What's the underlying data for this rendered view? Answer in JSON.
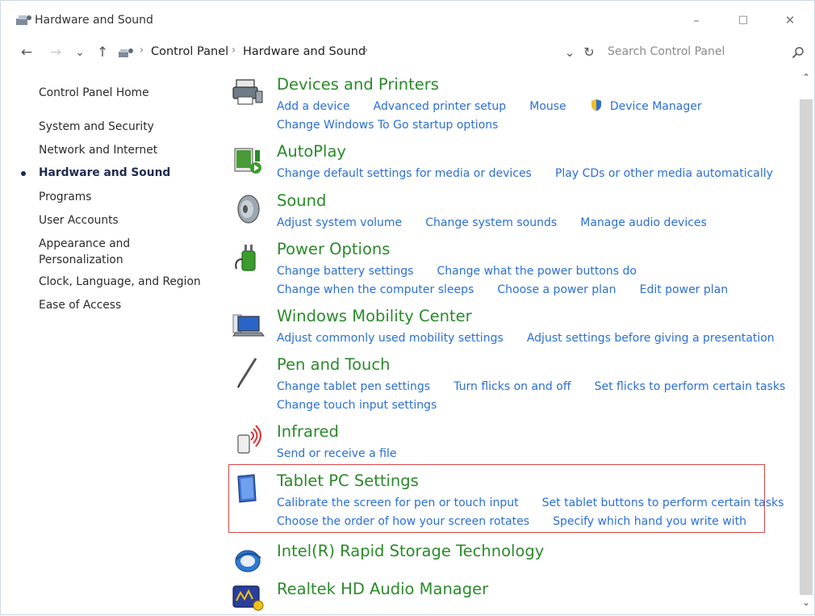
{
  "window": {
    "title": "Hardware and Sound",
    "minimize": "–",
    "maximize": "□",
    "close": "✕"
  },
  "address": {
    "back": "←",
    "forward": "→",
    "recent": "⌄",
    "up": "↑",
    "crumbs": [
      "Control Panel",
      "Hardware and Sound"
    ],
    "sep": "›",
    "dropdown": "⌄",
    "refresh": "↻",
    "search_placeholder": "Search Control Panel"
  },
  "sidebar": {
    "items": [
      {
        "label": "Control Panel Home"
      },
      {
        "label": "System and Security"
      },
      {
        "label": "Network and Internet"
      },
      {
        "label": "Hardware and Sound",
        "active": true
      },
      {
        "label": "Programs"
      },
      {
        "label": "User Accounts"
      },
      {
        "label": "Appearance and Personalization"
      },
      {
        "label": "Clock, Language, and Region"
      },
      {
        "label": "Ease of Access"
      }
    ]
  },
  "categories": [
    {
      "title": "Devices and Printers",
      "icon": "printer-icon",
      "lines": [
        [
          "Add a device",
          "Advanced printer setup",
          "Mouse",
          "Device Manager"
        ],
        [
          "Change Windows To Go startup options"
        ]
      ]
    },
    {
      "title": "AutoPlay",
      "icon": "autoplay-icon",
      "lines": [
        [
          "Change default settings for media or devices",
          "Play CDs or other media automatically"
        ]
      ]
    },
    {
      "title": "Sound",
      "icon": "speaker-icon",
      "lines": [
        [
          "Adjust system volume",
          "Change system sounds",
          "Manage audio devices"
        ]
      ]
    },
    {
      "title": "Power Options",
      "icon": "power-plug-icon",
      "lines": [
        [
          "Change battery settings",
          "Change what the power buttons do"
        ],
        [
          "Change when the computer sleeps",
          "Choose a power plan",
          "Edit power plan"
        ]
      ]
    },
    {
      "title": "Windows Mobility Center",
      "icon": "mobility-center-icon",
      "lines": [
        [
          "Adjust commonly used mobility settings",
          "Adjust settings before giving a presentation"
        ]
      ]
    },
    {
      "title": "Pen and Touch",
      "icon": "pen-icon",
      "lines": [
        [
          "Change tablet pen settings",
          "Turn flicks on and off",
          "Set flicks to perform certain tasks"
        ],
        [
          "Change touch input settings"
        ]
      ]
    },
    {
      "title": "Infrared",
      "icon": "infrared-icon",
      "lines": [
        [
          "Send or receive a file"
        ]
      ]
    },
    {
      "title": "Tablet PC Settings",
      "icon": "tablet-icon",
      "lines": [
        [
          "Calibrate the screen for pen or touch input",
          "Set tablet buttons to perform certain tasks"
        ],
        [
          "Choose the order of how your screen rotates",
          "Specify which hand you write with"
        ]
      ]
    },
    {
      "title": "Intel(R) Rapid Storage Technology",
      "icon": "intel-storage-icon",
      "lines": []
    },
    {
      "title": "Realtek HD Audio Manager",
      "icon": "realtek-audio-icon",
      "lines": []
    }
  ],
  "colors": {
    "title_green": "#2a8a2a",
    "link_blue": "#2a6fd6",
    "highlight_red": "#d94545"
  }
}
